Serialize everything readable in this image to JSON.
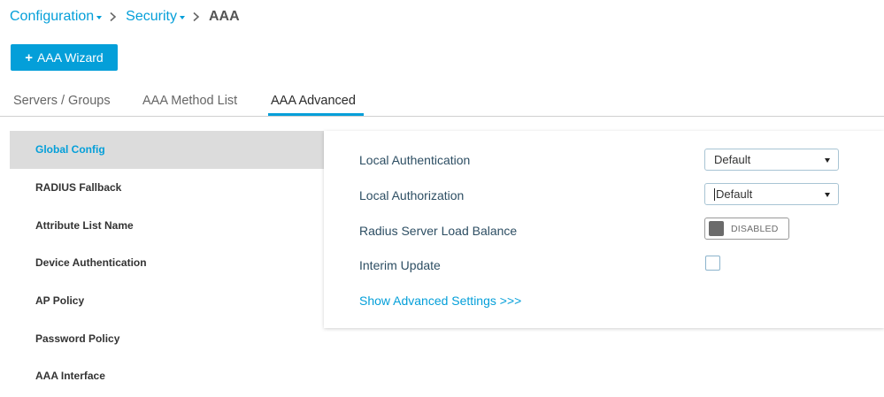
{
  "breadcrumb": {
    "items": [
      "Configuration",
      "Security"
    ],
    "current": "AAA"
  },
  "wizard_button": {
    "label": "AAA Wizard",
    "icon": "plus-icon"
  },
  "tabs": [
    {
      "label": "Servers / Groups",
      "active": false
    },
    {
      "label": "AAA Method List",
      "active": false
    },
    {
      "label": "AAA Advanced",
      "active": true
    }
  ],
  "sidebar": {
    "items": [
      {
        "label": "Global Config",
        "active": true
      },
      {
        "label": "RADIUS Fallback",
        "active": false
      },
      {
        "label": "Attribute List Name",
        "active": false
      },
      {
        "label": "Device Authentication",
        "active": false
      },
      {
        "label": "AP Policy",
        "active": false
      },
      {
        "label": "Password Policy",
        "active": false
      },
      {
        "label": "AAA Interface",
        "active": false
      }
    ]
  },
  "settings": {
    "local_authentication": {
      "label": "Local Authentication",
      "value": "Default"
    },
    "local_authorization": {
      "label": "Local Authorization",
      "value": "Default"
    },
    "radius_load_balance": {
      "label": "Radius Server Load Balance",
      "toggle_text": "DISABLED",
      "enabled": false
    },
    "interim_update": {
      "label": "Interim Update",
      "checked": false
    },
    "advanced_link": "Show Advanced Settings >>>"
  },
  "colors": {
    "accent": "#049fd9",
    "nav_active_bg": "#dcdcdc",
    "label_text": "#2d4e63",
    "toggle_off": "#6b6b6b"
  }
}
